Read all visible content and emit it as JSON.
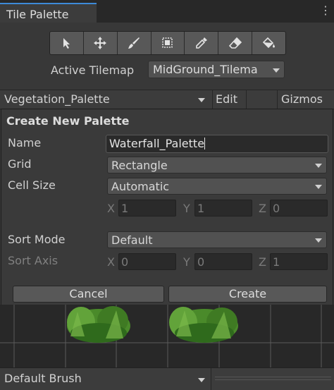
{
  "window": {
    "tab_title": "Tile Palette",
    "menu_icon": "kebab-menu-icon"
  },
  "toolbar": {
    "tools": [
      {
        "name": "select-tool",
        "icon": "arrow-cursor-icon"
      },
      {
        "name": "move-tool",
        "icon": "move-arrows-icon"
      },
      {
        "name": "paint-tool",
        "icon": "paintbrush-icon"
      },
      {
        "name": "box-fill-tool",
        "icon": "box-select-icon"
      },
      {
        "name": "pick-tool",
        "icon": "eyedropper-icon"
      },
      {
        "name": "erase-tool",
        "icon": "eraser-icon"
      },
      {
        "name": "fill-tool",
        "icon": "paint-bucket-icon"
      }
    ]
  },
  "active_tilemap": {
    "label": "Active Tilemap",
    "value": "MidGround_Tilema"
  },
  "palette_bar": {
    "selected": "Vegetation_Palette",
    "edit": "Edit",
    "gizmos": "Gizmos"
  },
  "create_palette": {
    "title": "Create New Palette",
    "name_label": "Name",
    "name_value": "Waterfall_Palette",
    "grid_label": "Grid",
    "grid_value": "Rectangle",
    "cell_size_label": "Cell Size",
    "cell_size_value": "Automatic",
    "cell_xyz": {
      "x_label": "X",
      "x": "1",
      "y_label": "Y",
      "y": "1",
      "z_label": "Z",
      "z": "0"
    },
    "sort_mode_label": "Sort Mode",
    "sort_mode_value": "Default",
    "sort_axis_label": "Sort Axis",
    "sort_xyz": {
      "x_label": "X",
      "x": "0",
      "y_label": "Y",
      "y": "0",
      "z_label": "Z",
      "z": "1"
    },
    "cancel": "Cancel",
    "create": "Create"
  },
  "brush_bar": {
    "brush": "Default Brush"
  },
  "colors": {
    "accent": "#3d8ad8",
    "bg": "#383838",
    "input_dark": "#2a2a2a",
    "foliage": "#4f8f2c"
  }
}
